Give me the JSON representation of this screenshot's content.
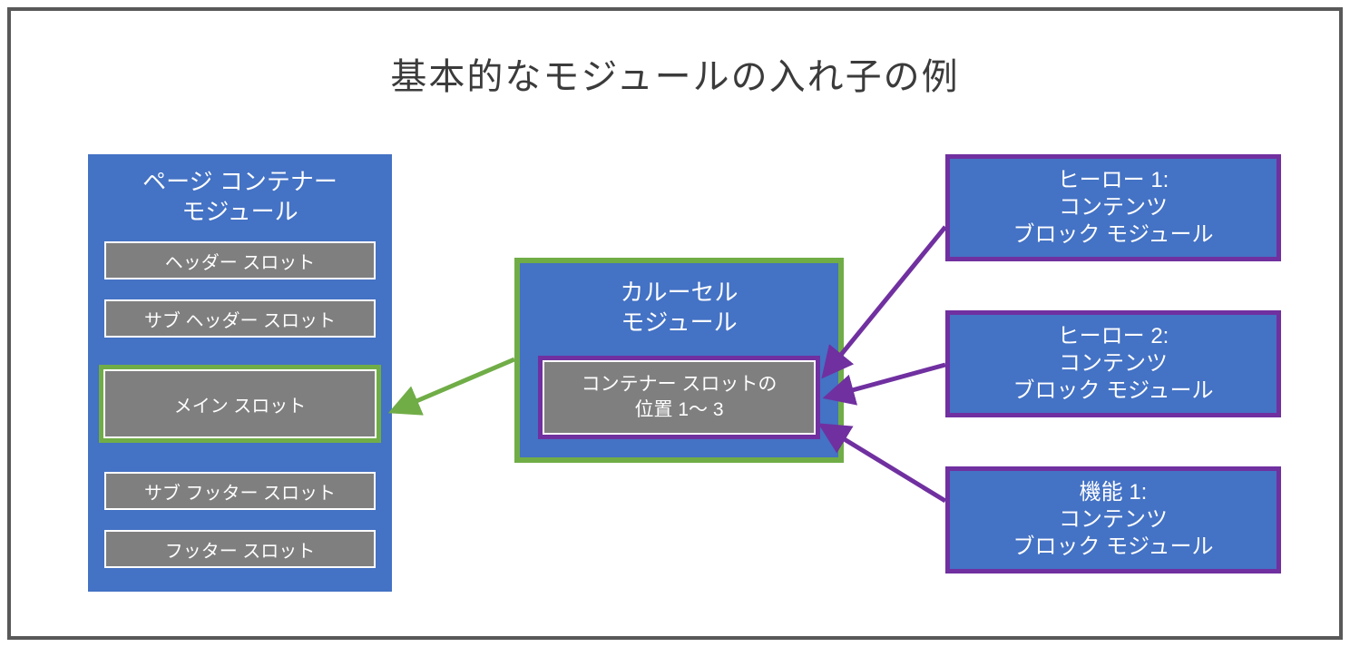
{
  "title": "基本的なモジュールの入れ子の例",
  "pageContainer": {
    "title_l1": "ページ コンテナー",
    "title_l2": "モジュール",
    "slots": {
      "header": "ヘッダー スロット",
      "subheader": "サブ ヘッダー スロット",
      "main": "メイン スロット",
      "subfooter": "サブ フッター スロット",
      "footer": "フッター スロット"
    }
  },
  "carousel": {
    "title_l1": "カルーセル",
    "title_l2": "モジュール",
    "slot_l1": "コンテナー スロットの",
    "slot_l2": "位置 1～ 3"
  },
  "contentBlocks": {
    "hero1_l1": "ヒーロー 1:",
    "hero1_l2": "コンテンツ",
    "hero1_l3": "ブロック モジュール",
    "hero2_l1": "ヒーロー 2:",
    "hero2_l2": "コンテンツ",
    "hero2_l3": "ブロック モジュール",
    "feature1_l1": "機能 1:",
    "feature1_l2": "コンテンツ",
    "feature1_l3": "ブロック モジュール"
  },
  "colors": {
    "frame": "#595959",
    "module_bg": "#4472C4",
    "slot_bg": "#7F7F7F",
    "green": "#70AD47",
    "purple": "#7030A0"
  }
}
